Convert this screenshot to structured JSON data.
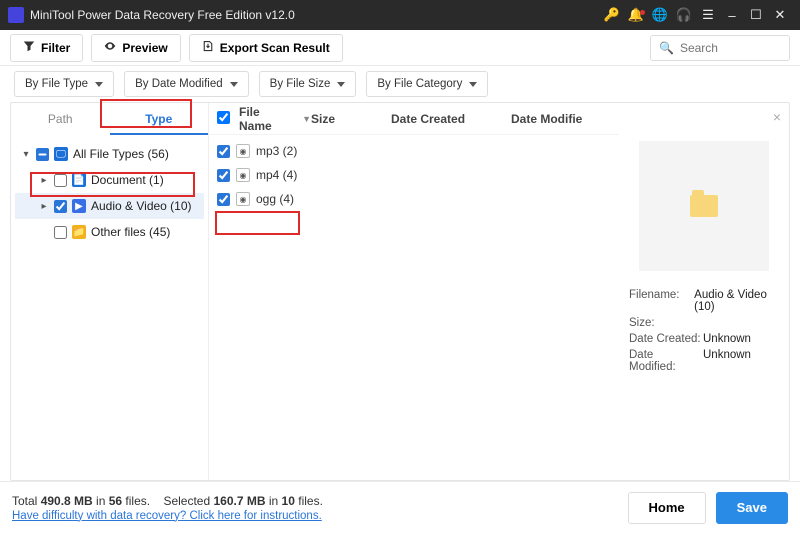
{
  "titlebar": {
    "title": "MiniTool Power Data Recovery Free Edition v12.0"
  },
  "toolbar": {
    "filter": "Filter",
    "preview": "Preview",
    "export": "Export Scan Result"
  },
  "search": {
    "placeholder": "Search"
  },
  "filters": {
    "type": "By File Type",
    "date": "By Date Modified",
    "size": "By File Size",
    "cat": "By File Category"
  },
  "tabs": {
    "path": "Path",
    "type": "Type"
  },
  "tree": {
    "all": {
      "label": "All File Types (56)"
    },
    "doc": {
      "label": "Document (1)"
    },
    "av": {
      "label": "Audio & Video (10)"
    },
    "other": {
      "label": "Other files (45)"
    }
  },
  "columns": {
    "name": "File Name",
    "size": "Size",
    "dc": "Date Created",
    "dm": "Date Modifie"
  },
  "rows": {
    "r0": {
      "label": "mp3 (2)"
    },
    "r1": {
      "label": "mp4 (4)"
    },
    "r2": {
      "label": "ogg (4)"
    }
  },
  "details": {
    "filename_k": "Filename:",
    "filename_v": "Audio & Video (10)",
    "size_k": "Size:",
    "size_v": "",
    "dc_k": "Date Created:",
    "dc_v": "Unknown",
    "dm_k": "Date Modified:",
    "dm_v": "Unknown"
  },
  "footer": {
    "total_pre": "Total ",
    "total_mb": "490.8 MB",
    "total_mid": " in ",
    "total_files": "56",
    "total_suf": " files.",
    "sel_pre": "Selected ",
    "sel_mb": "160.7 MB",
    "sel_mid": " in ",
    "sel_files": "10",
    "sel_suf": " files.",
    "help": "Have difficulty with data recovery? Click here for instructions.",
    "home": "Home",
    "save": "Save"
  }
}
